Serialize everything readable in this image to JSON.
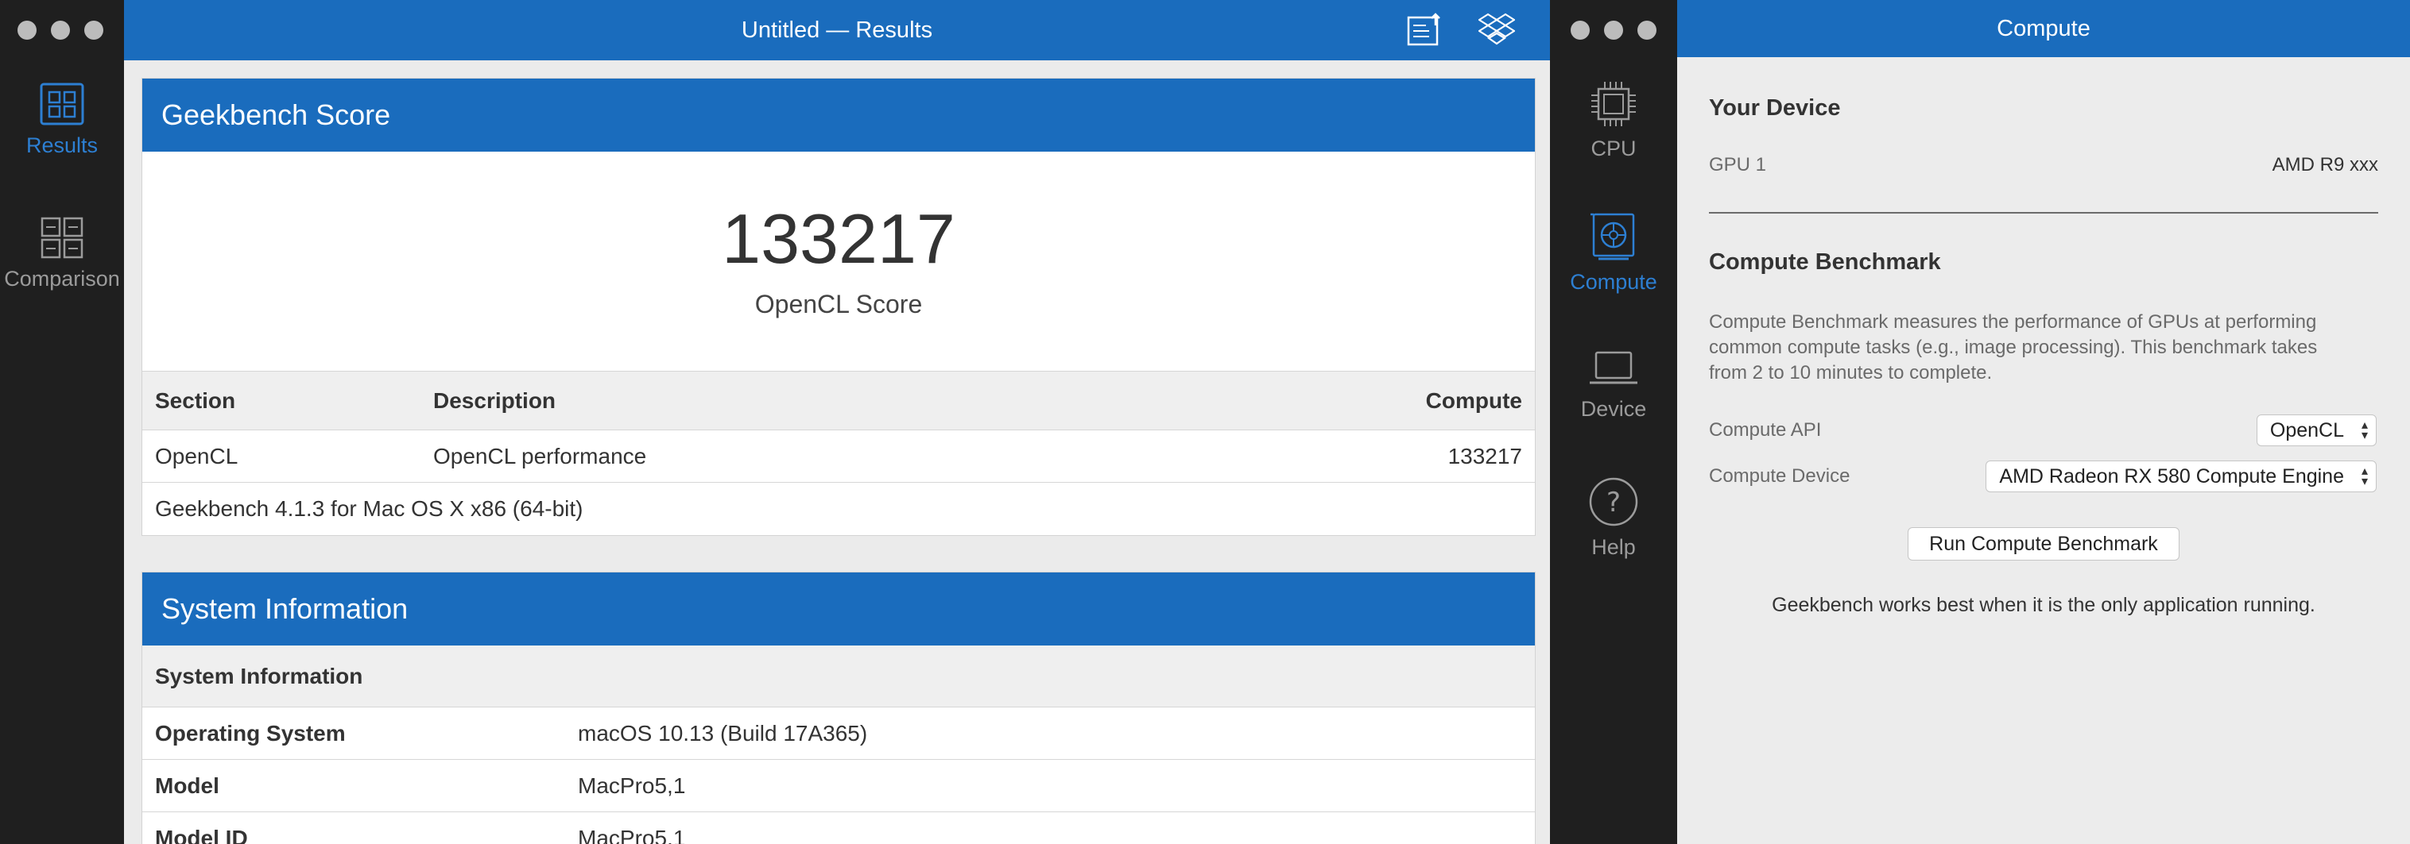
{
  "results_window": {
    "title": "Untitled — Results",
    "sidebar": {
      "items": [
        {
          "label": "Results",
          "icon": "results-icon",
          "active": true
        },
        {
          "label": "Comparison",
          "icon": "comparison-icon",
          "active": false
        }
      ]
    },
    "toolbar": {
      "icons": [
        "upload-results-icon",
        "dropbox-icon"
      ]
    },
    "score_panel": {
      "header": "Geekbench Score",
      "score": "133217",
      "score_label": "OpenCL Score",
      "table": {
        "columns": [
          "Section",
          "Description",
          "Compute"
        ],
        "rows": [
          {
            "section": "OpenCL",
            "description": "OpenCL performance",
            "compute": "133217"
          }
        ],
        "footer": "Geekbench 4.1.3 for Mac OS X x86 (64-bit)"
      }
    },
    "system_panel": {
      "header": "System Information",
      "subheader": "System Information",
      "rows": [
        {
          "label": "Operating System",
          "value": "macOS 10.13 (Build 17A365)"
        },
        {
          "label": "Model",
          "value": "MacPro5,1"
        },
        {
          "label": "Model ID",
          "value": "MacPro5,1"
        }
      ]
    }
  },
  "compute_window": {
    "title": "Compute",
    "sidebar": {
      "items": [
        {
          "label": "CPU",
          "icon": "cpu-icon",
          "active": false
        },
        {
          "label": "Compute",
          "icon": "compute-icon",
          "active": true
        },
        {
          "label": "Device",
          "icon": "laptop-icon",
          "active": false
        },
        {
          "label": "Help",
          "icon": "help-icon",
          "active": false
        }
      ]
    },
    "your_device": {
      "title": "Your Device",
      "gpu_label": "GPU 1",
      "gpu_value": "AMD R9 xxx"
    },
    "benchmark": {
      "title": "Compute Benchmark",
      "description_lines": [
        "Compute Benchmark measures the performance of GPUs at performing",
        "common compute tasks (e.g., image processing). This benchmark takes",
        "from 2 to 10 minutes to complete."
      ],
      "api_label": "Compute API",
      "api_value": "OpenCL",
      "device_label": "Compute Device",
      "device_value": "AMD Radeon RX 580 Compute Engine",
      "run_button": "Run Compute Benchmark",
      "note": "Geekbench works best when it is the only application running."
    }
  },
  "colors": {
    "accent": "#1a6cbd",
    "sidebar_active": "#2d7fd2",
    "sidebar_bg": "#1f1f1f"
  }
}
